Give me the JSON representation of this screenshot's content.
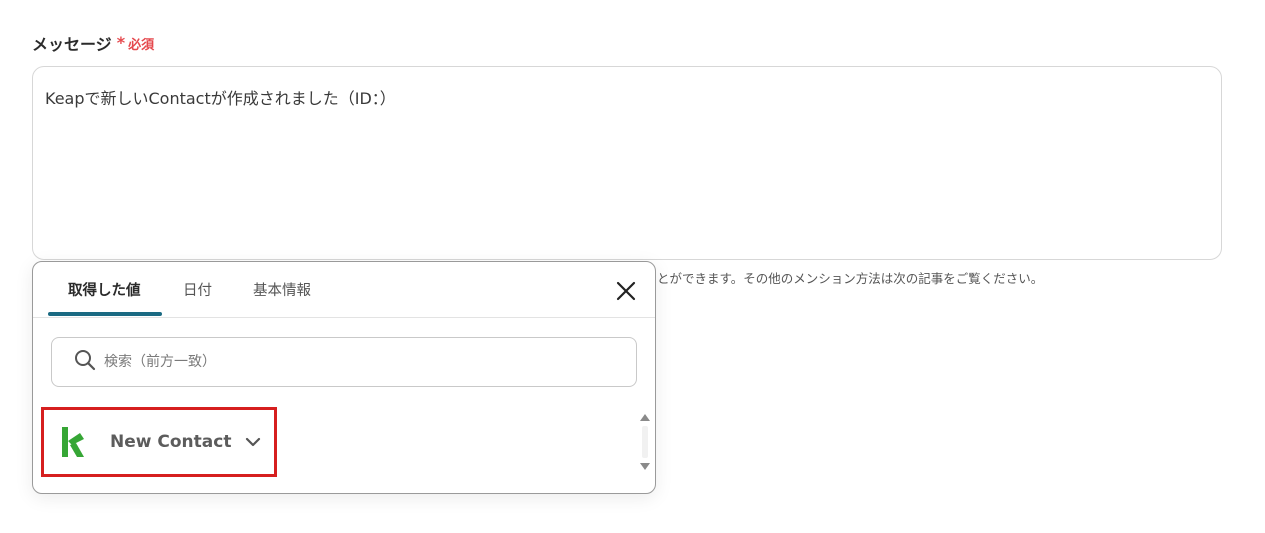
{
  "field": {
    "label": "メッセージ",
    "required_star": "*",
    "required_text": "必須",
    "value": "Keapで新しいContactが作成されました（ID：）",
    "helper_text": "とができます。その他のメンション方法は次の記事をご覧ください。"
  },
  "popup": {
    "tabs": [
      {
        "label": "取得した値",
        "active": true
      },
      {
        "label": "日付",
        "active": false
      },
      {
        "label": "基本情報",
        "active": false
      }
    ],
    "search": {
      "placeholder": "検索（前方一致）"
    },
    "items": [
      {
        "label": "New Contact",
        "icon": "keap-logo-icon"
      }
    ]
  },
  "colors": {
    "required": "#e5484d",
    "tab_underline": "#1a6a82",
    "highlight_box": "#d61f1f",
    "keap_green": "#36a635"
  }
}
